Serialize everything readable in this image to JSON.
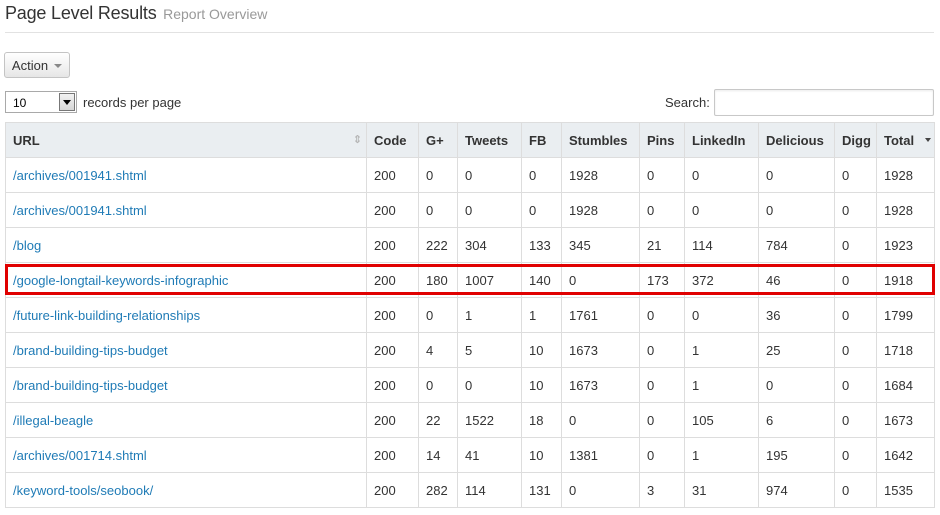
{
  "header": {
    "title": "Page Level Results",
    "subtitle": "Report Overview"
  },
  "toolbar": {
    "action_label": "Action"
  },
  "controls": {
    "records_per_page_value": "10",
    "records_per_page_label": "records per page",
    "search_label": "Search:",
    "search_value": ""
  },
  "colors": {
    "link": "#1f7bb6",
    "highlight_border": "#e00000",
    "header_bg": "#eaeef1"
  },
  "table": {
    "columns": [
      "URL",
      "Code",
      "G+",
      "Tweets",
      "FB",
      "Stumbles",
      "Pins",
      "LinkedIn",
      "Delicious",
      "Digg",
      "Total"
    ],
    "highlighted_row_index": 3,
    "rows": [
      [
        "/archives/001941.shtml",
        "200",
        "0",
        "0",
        "0",
        "1928",
        "0",
        "0",
        "0",
        "0",
        "1928"
      ],
      [
        "/archives/001941.shtml",
        "200",
        "0",
        "0",
        "0",
        "1928",
        "0",
        "0",
        "0",
        "0",
        "1928"
      ],
      [
        "/blog",
        "200",
        "222",
        "304",
        "133",
        "345",
        "21",
        "114",
        "784",
        "0",
        "1923"
      ],
      [
        "/google-longtail-keywords-infographic",
        "200",
        "180",
        "1007",
        "140",
        "0",
        "173",
        "372",
        "46",
        "0",
        "1918"
      ],
      [
        "/future-link-building-relationships",
        "200",
        "0",
        "1",
        "1",
        "1761",
        "0",
        "0",
        "36",
        "0",
        "1799"
      ],
      [
        "/brand-building-tips-budget",
        "200",
        "4",
        "5",
        "10",
        "1673",
        "0",
        "1",
        "25",
        "0",
        "1718"
      ],
      [
        "/brand-building-tips-budget",
        "200",
        "0",
        "0",
        "10",
        "1673",
        "0",
        "1",
        "0",
        "0",
        "1684"
      ],
      [
        "/illegal-beagle",
        "200",
        "22",
        "1522",
        "18",
        "0",
        "0",
        "105",
        "6",
        "0",
        "1673"
      ],
      [
        "/archives/001714.shtml",
        "200",
        "14",
        "41",
        "10",
        "1381",
        "0",
        "1",
        "195",
        "0",
        "1642"
      ],
      [
        "/keyword-tools/seobook/",
        "200",
        "282",
        "114",
        "131",
        "0",
        "3",
        "31",
        "974",
        "0",
        "1535"
      ]
    ]
  }
}
